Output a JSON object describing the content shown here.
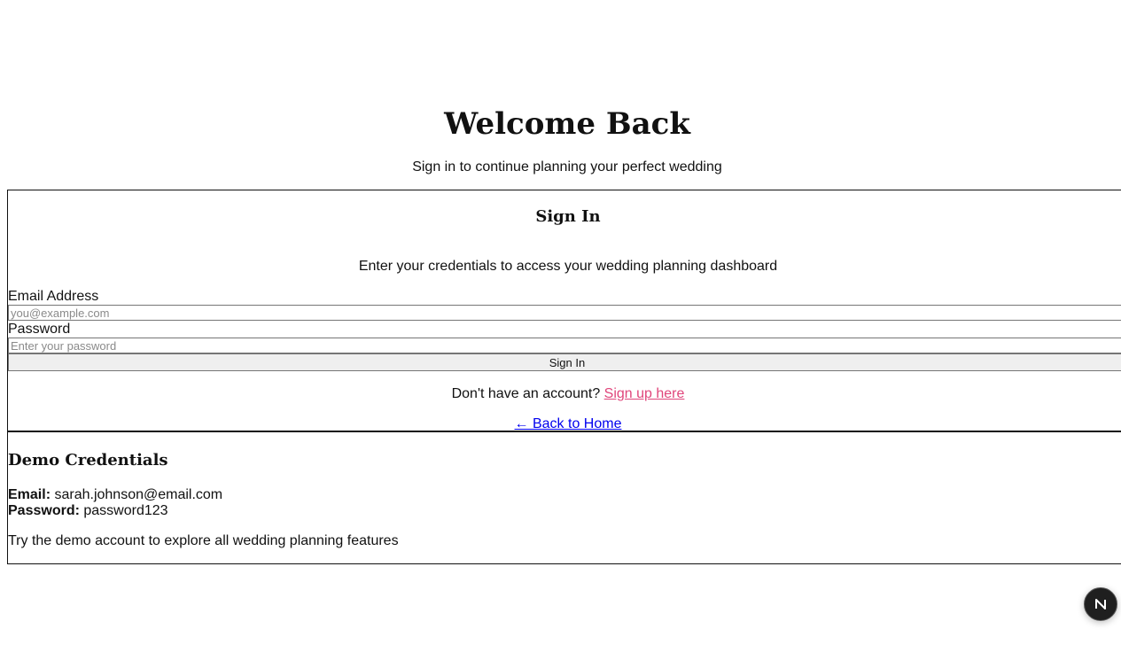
{
  "header": {
    "title": "Welcome Back",
    "subtitle": "Sign in to continue planning your perfect wedding"
  },
  "signin_card": {
    "title": "Sign In",
    "description": "Enter your credentials to access your wedding planning dashboard",
    "email": {
      "label": "Email Address",
      "placeholder": "you@example.com",
      "value": ""
    },
    "password": {
      "label": "Password",
      "placeholder": "Enter your password",
      "value": ""
    },
    "submit_label": "Sign In",
    "signup_prompt": "Don't have an account?",
    "signup_link": "Sign up here",
    "back_link": "← Back to Home"
  },
  "demo": {
    "title": "Demo Credentials",
    "email_label": "Email:",
    "email_value": "sarah.johnson@email.com",
    "password_label": "Password:",
    "password_value": "password123",
    "note": "Try the demo account to explore all wedding planning features"
  },
  "dev_badge": {
    "icon": "nextjs-logo-icon",
    "letter": "N"
  },
  "colors": {
    "signup_link": "#e0457b",
    "back_link": "#0000ee",
    "badge_bg": "#1f1f1f"
  }
}
